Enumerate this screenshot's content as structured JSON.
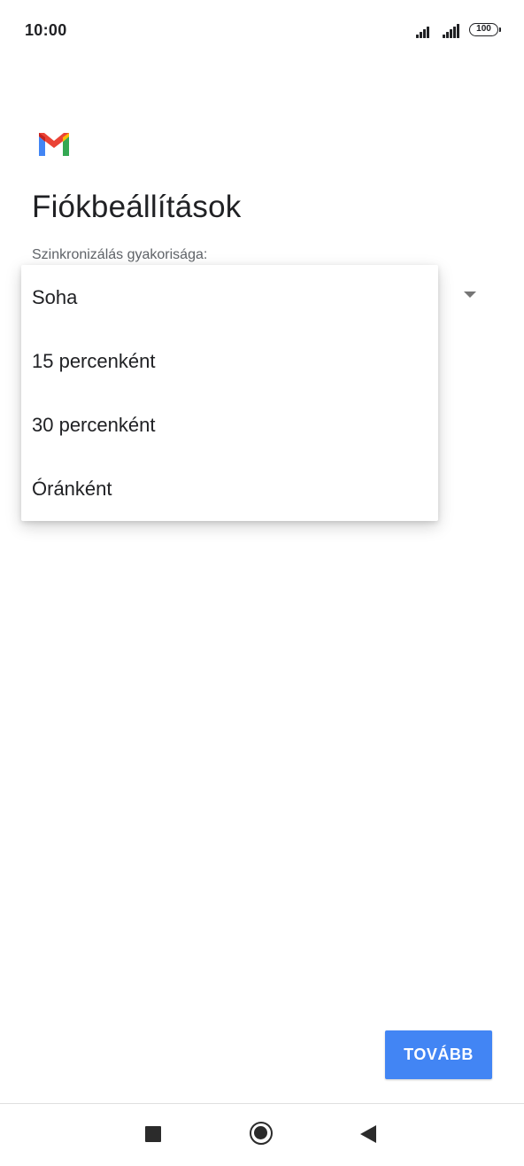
{
  "status_bar": {
    "time": "10:00",
    "battery": "100",
    "icons": [
      "signal-icon",
      "signal-icon",
      "battery-icon"
    ]
  },
  "app": {
    "logo_icon": "gmail-logo-icon",
    "colors": {
      "gmail_red": "#ea4335",
      "gmail_blue": "#4285f4",
      "gmail_green": "#34a853",
      "gmail_yellow": "#fbbc04"
    }
  },
  "page": {
    "title": "Fiókbeállítások",
    "sync_label": "Szinkronizálás gyakorisága:"
  },
  "dropdown": {
    "arrow_icon": "dropdown-arrow-icon",
    "options": [
      {
        "label": "Soha"
      },
      {
        "label": "15 percenként"
      },
      {
        "label": "30 percenként"
      },
      {
        "label": "Óránként"
      }
    ]
  },
  "actions": {
    "next_label": "TOVÁBB",
    "accent": "#4285f4"
  },
  "nav_bar": {
    "icons": [
      "recent-apps-icon",
      "home-icon",
      "back-icon"
    ]
  }
}
